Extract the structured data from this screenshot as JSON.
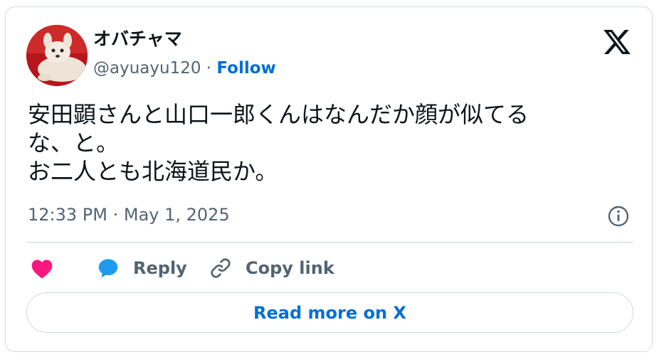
{
  "author": {
    "display_name": "オバチャマ",
    "handle": "@ayuayu120",
    "separator": " · ",
    "follow_label": "Follow"
  },
  "tweet": {
    "lines": [
      "安田顕さんと山口一郎くんはなんだか顔が似てる",
      "な、と。",
      "お二人とも北海道民か。"
    ],
    "timestamp": "12:33 PM · May 1, 2025"
  },
  "actions": {
    "like_icon": "heart-icon",
    "reply_label": "Reply",
    "reply_icon": "speech-bubble-icon",
    "copy_label": "Copy link",
    "copy_icon": "link-icon"
  },
  "read_more_label": "Read more on X",
  "icons": {
    "brand": "x-logo-icon",
    "info": "info-icon"
  },
  "colors": {
    "text": "#0f1419",
    "secondary": "#536471",
    "link": "#006fd6",
    "like": "#f91880",
    "reply": "#1d9bf0",
    "border": "#cfd9de"
  }
}
